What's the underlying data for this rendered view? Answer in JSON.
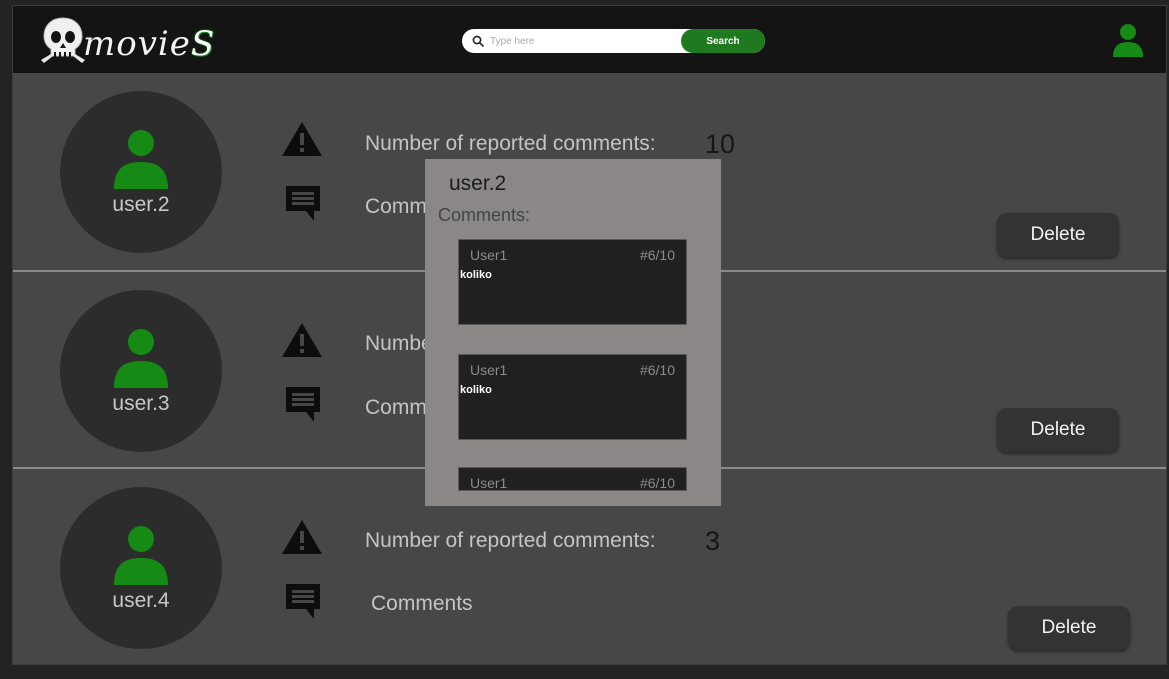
{
  "app": {
    "logo_text_main": "movie",
    "logo_text_accent": "S",
    "logo_icon": "skull-icon"
  },
  "header": {
    "search_placeholder": "Type here",
    "search_button": "Search",
    "search_icon": "search-icon",
    "profile_icon": "user-icon"
  },
  "colors": {
    "accent": "#1f7a1f",
    "avatar_icon": "#158a15",
    "background": "#474747",
    "popup": "#8a8786"
  },
  "reports": [
    {
      "username": "user.2",
      "reported_label": "Number of reported comments:",
      "reported_count": "10",
      "comments_label": "Comments",
      "delete_label": "Delete"
    },
    {
      "username": "user.3",
      "reported_label": "Number of reported comments:",
      "reported_count": "",
      "comments_label": "Comments",
      "delete_label": "Delete"
    },
    {
      "username": "user.4",
      "reported_label": "Number of reported comments:",
      "reported_count": "3",
      "comments_label": "Comments",
      "delete_label": "Delete"
    }
  ],
  "popup": {
    "username": "user.2",
    "comments_title": "Comments:",
    "comments": [
      {
        "user": "User1",
        "rating": "#6/10",
        "text": "koliko"
      },
      {
        "user": "User1",
        "rating": "#6/10",
        "text": "koliko"
      },
      {
        "user": "User1",
        "rating": "#6/10",
        "text": ""
      }
    ]
  }
}
